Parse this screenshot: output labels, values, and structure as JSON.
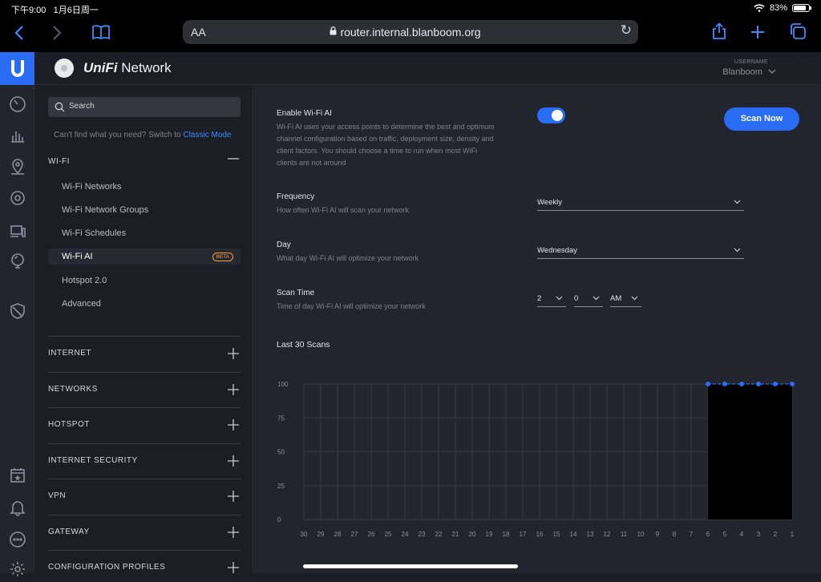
{
  "status": {
    "time": "下午9:00",
    "date": "1月6日周一",
    "battery": "83%"
  },
  "browser": {
    "text_size": "AA",
    "url": "router.internal.blanboom.org"
  },
  "app": {
    "brand_prefix": "UniFi",
    "brand_suffix": "Network",
    "username_label": "USERNAME",
    "username": "Blanboom"
  },
  "sidebar": {
    "search_placeholder": "Search",
    "classic_text": "Can't find what you need? Switch to ",
    "classic_link": "Classic Mode",
    "wifi_header": "WI-FI",
    "wifi_items": [
      "Wi-Fi Networks",
      "Wi-Fi Network Groups",
      "Wi-Fi Schedules",
      "Wi-Fi AI",
      "Hotspot 2.0",
      "Advanced"
    ],
    "beta_badge": "BETA",
    "sections": [
      "INTERNET",
      "NETWORKS",
      "HOTSPOT",
      "INTERNET SECURITY",
      "VPN",
      "GATEWAY",
      "CONFIGURATION PROFILES"
    ]
  },
  "main": {
    "enable_label": "Enable Wi-Fi AI",
    "enable_desc": "Wi-Fi AI uses your access points to determine the best and optimum channel configuration based on traffic, deployment size, density and client factors. You should choose a time to run when most WiFi clients are not around",
    "enabled": true,
    "scan_button": "Scan Now",
    "frequency_label": "Frequency",
    "frequency_desc": "How often Wi-Fi AI will scan your network",
    "frequency_value": "Weekly",
    "day_label": "Day",
    "day_desc": "What day Wi-Fi AI will optimize your network",
    "day_value": "Wednesday",
    "scantime_label": "Scan Time",
    "scantime_desc": "Time of day Wi-Fi AI will optimize your network",
    "hour_value": "2",
    "minute_value": "0",
    "ampm_value": "AM",
    "scans_title": "Last 30 Scans"
  },
  "chart_data": {
    "type": "area",
    "x": [
      30,
      29,
      28,
      27,
      26,
      25,
      24,
      23,
      22,
      21,
      20,
      19,
      18,
      17,
      16,
      15,
      14,
      13,
      12,
      11,
      10,
      9,
      8,
      7,
      6,
      5,
      4,
      3,
      2,
      1
    ],
    "x_tick_labels": [
      "30",
      "29",
      "28",
      "27",
      "26",
      "25",
      "24",
      "23",
      "22",
      "21",
      "20",
      "19",
      "18",
      "17",
      "16",
      "15",
      "14",
      "13",
      "12",
      "11",
      "10",
      "9",
      "8",
      "7",
      "6",
      "5",
      "4",
      "3",
      "2",
      "1"
    ],
    "y_ticks": [
      0,
      25,
      50,
      75,
      100
    ],
    "series": [
      {
        "values": [
          null,
          null,
          null,
          null,
          null,
          null,
          null,
          null,
          null,
          null,
          null,
          null,
          null,
          null,
          null,
          null,
          null,
          null,
          null,
          null,
          null,
          null,
          null,
          null,
          100,
          100,
          100,
          100,
          100,
          100
        ],
        "color": "#2a6df4",
        "fill": "#000000"
      }
    ],
    "ylim": [
      0,
      100
    ],
    "grid": true
  }
}
